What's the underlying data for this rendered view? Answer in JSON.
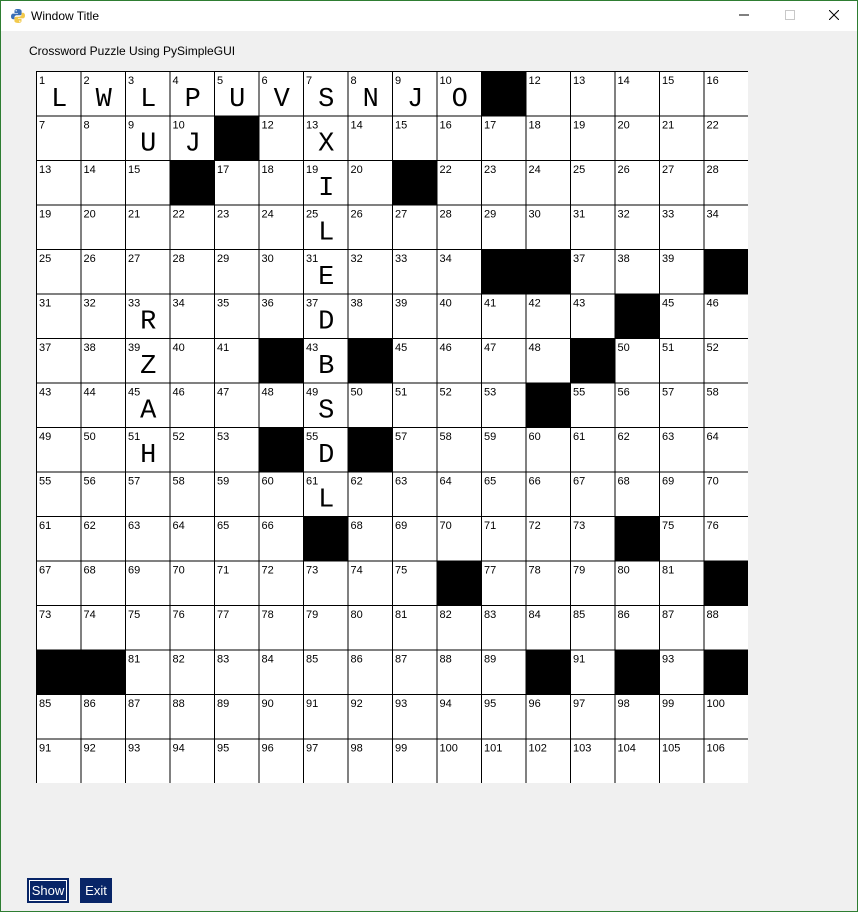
{
  "window": {
    "title": "Window Title",
    "icon": "python-icon"
  },
  "heading": "Crossword Puzzle Using PySimpleGUI",
  "grid": {
    "rows": 16,
    "cols": 16,
    "numbers": [
      [
        1,
        2,
        3,
        4,
        5,
        6,
        7,
        8,
        9,
        10,
        null,
        12,
        13,
        14,
        15,
        16
      ],
      [
        7,
        8,
        9,
        10,
        null,
        12,
        13,
        14,
        15,
        16,
        17,
        18,
        19,
        20,
        21,
        22
      ],
      [
        13,
        14,
        15,
        null,
        17,
        18,
        19,
        20,
        null,
        22,
        23,
        24,
        25,
        26,
        27,
        28
      ],
      [
        19,
        20,
        21,
        22,
        23,
        24,
        25,
        26,
        27,
        28,
        29,
        30,
        31,
        32,
        33,
        34
      ],
      [
        25,
        26,
        27,
        28,
        29,
        30,
        31,
        32,
        33,
        34,
        null,
        null,
        37,
        38,
        39,
        null
      ],
      [
        31,
        32,
        33,
        34,
        35,
        36,
        37,
        38,
        39,
        40,
        41,
        42,
        43,
        null,
        45,
        46
      ],
      [
        37,
        38,
        39,
        40,
        41,
        null,
        43,
        null,
        45,
        46,
        47,
        48,
        null,
        50,
        51,
        52
      ],
      [
        43,
        44,
        45,
        46,
        47,
        48,
        49,
        50,
        51,
        52,
        53,
        null,
        55,
        56,
        57,
        58
      ],
      [
        49,
        50,
        51,
        52,
        53,
        null,
        55,
        null,
        57,
        58,
        59,
        60,
        61,
        62,
        63,
        64
      ],
      [
        55,
        56,
        57,
        58,
        59,
        60,
        61,
        62,
        63,
        64,
        65,
        66,
        67,
        68,
        69,
        70
      ],
      [
        61,
        62,
        63,
        64,
        65,
        66,
        null,
        68,
        69,
        70,
        71,
        72,
        73,
        null,
        75,
        76
      ],
      [
        67,
        68,
        69,
        70,
        71,
        72,
        73,
        74,
        75,
        null,
        77,
        78,
        79,
        80,
        81,
        null
      ],
      [
        73,
        74,
        75,
        76,
        77,
        78,
        79,
        80,
        81,
        82,
        83,
        84,
        85,
        86,
        87,
        88
      ],
      [
        null,
        null,
        81,
        82,
        83,
        84,
        85,
        86,
        87,
        88,
        89,
        null,
        91,
        null,
        93,
        null
      ],
      [
        85,
        86,
        87,
        88,
        89,
        90,
        91,
        92,
        93,
        94,
        95,
        96,
        97,
        98,
        99,
        100
      ],
      [
        91,
        92,
        93,
        94,
        95,
        96,
        97,
        98,
        99,
        100,
        101,
        102,
        103,
        104,
        105,
        106
      ]
    ],
    "black": [
      [
        0,
        10
      ],
      [
        1,
        4
      ],
      [
        2,
        3
      ],
      [
        2,
        8
      ],
      [
        4,
        10
      ],
      [
        4,
        11
      ],
      [
        4,
        15
      ],
      [
        5,
        13
      ],
      [
        6,
        5
      ],
      [
        6,
        7
      ],
      [
        6,
        12
      ],
      [
        7,
        11
      ],
      [
        8,
        5
      ],
      [
        8,
        7
      ],
      [
        10,
        6
      ],
      [
        10,
        13
      ],
      [
        11,
        9
      ],
      [
        11,
        15
      ],
      [
        13,
        0
      ],
      [
        13,
        1
      ],
      [
        13,
        11
      ],
      [
        13,
        13
      ],
      [
        13,
        15
      ]
    ],
    "letters": [
      {
        "r": 0,
        "c": 0,
        "ch": "L"
      },
      {
        "r": 0,
        "c": 1,
        "ch": "W"
      },
      {
        "r": 0,
        "c": 2,
        "ch": "L"
      },
      {
        "r": 0,
        "c": 3,
        "ch": "P"
      },
      {
        "r": 0,
        "c": 4,
        "ch": "U"
      },
      {
        "r": 0,
        "c": 5,
        "ch": "V"
      },
      {
        "r": 0,
        "c": 6,
        "ch": "S"
      },
      {
        "r": 0,
        "c": 7,
        "ch": "N"
      },
      {
        "r": 0,
        "c": 8,
        "ch": "J"
      },
      {
        "r": 0,
        "c": 9,
        "ch": "O"
      },
      {
        "r": 1,
        "c": 2,
        "ch": "U"
      },
      {
        "r": 1,
        "c": 3,
        "ch": "J"
      },
      {
        "r": 1,
        "c": 6,
        "ch": "X"
      },
      {
        "r": 2,
        "c": 6,
        "ch": "I"
      },
      {
        "r": 3,
        "c": 6,
        "ch": "L"
      },
      {
        "r": 4,
        "c": 6,
        "ch": "E"
      },
      {
        "r": 5,
        "c": 2,
        "ch": "R"
      },
      {
        "r": 5,
        "c": 6,
        "ch": "D"
      },
      {
        "r": 6,
        "c": 2,
        "ch": "Z"
      },
      {
        "r": 6,
        "c": 6,
        "ch": "B"
      },
      {
        "r": 7,
        "c": 2,
        "ch": "A"
      },
      {
        "r": 7,
        "c": 6,
        "ch": "S"
      },
      {
        "r": 8,
        "c": 2,
        "ch": "H"
      },
      {
        "r": 8,
        "c": 6,
        "ch": "D"
      },
      {
        "r": 9,
        "c": 6,
        "ch": "L"
      }
    ]
  },
  "buttons": {
    "show_label": "Show",
    "exit_label": "Exit"
  },
  "colors": {
    "button_bg": "#082567",
    "window_border": "#2e7d32"
  }
}
